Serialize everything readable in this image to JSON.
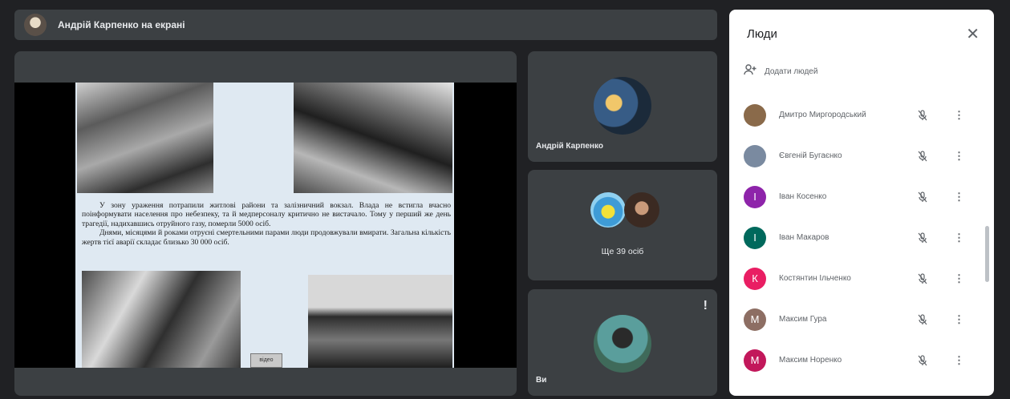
{
  "banner": {
    "text": "Андрій Карпенко на екрані"
  },
  "presentation": {
    "paragraph1": "У зону ураження потрапили житлові райони та залізничний вокзал. Влада не встигла вчасно поінформувати населення про небезпеку, та й медперсоналу критично не вистачало. Тому у перший же день трагедії, надихавшись отруйного газу, померли 5000 осіб.",
    "paragraph2": "Днями, місяцями й роками отруєні смертельними парами люди продовжували вмирати. Загальна кількість жертв тієї аварії складає близько 30 000 осіб.",
    "button_label": "відео"
  },
  "tiles": {
    "tile1_name": "Андрій Карпенко",
    "tile2_label": "Ще 39 осіб",
    "tile3_name": "Ви",
    "tile3_indicator": "!"
  },
  "panel": {
    "title": "Люди",
    "close_icon": "✕",
    "add_people_icon": "person-add-icon",
    "add_people_label": "Додати людей",
    "participants": [
      {
        "name": "Дмитро Миргородський",
        "initial": "",
        "color": "#8a6a4a"
      },
      {
        "name": "Євгеній Бугаєнко",
        "initial": "",
        "color": "#7a8aa0"
      },
      {
        "name": "Іван Косенко",
        "initial": "І",
        "color": "#8e24aa"
      },
      {
        "name": "Іван Макаров",
        "initial": "І",
        "color": "#00695c"
      },
      {
        "name": "Костянтин Ільченко",
        "initial": "К",
        "color": "#e91e63"
      },
      {
        "name": "Максим Гура",
        "initial": "М",
        "color": "#8d6e63"
      },
      {
        "name": "Максим Норенко",
        "initial": "М",
        "color": "#c2185b"
      }
    ]
  }
}
